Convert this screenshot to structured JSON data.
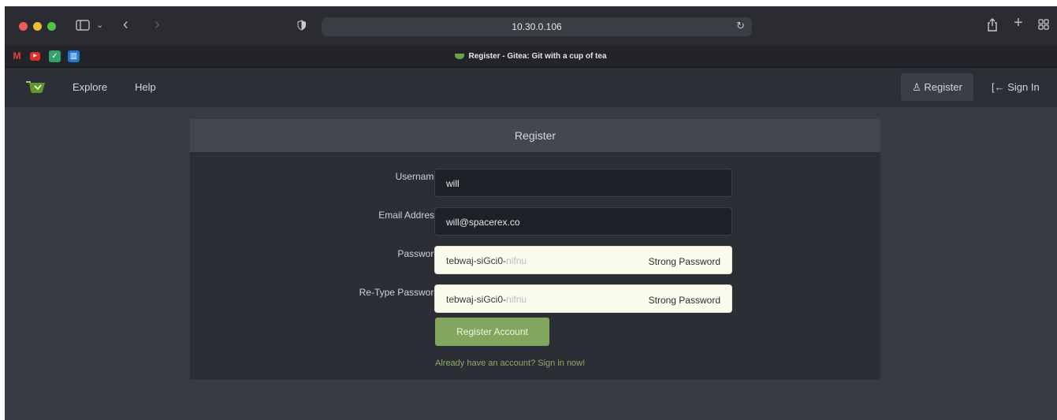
{
  "browser": {
    "url": "10.30.0.106",
    "tab_title": "Register - Gitea: Git with a cup of tea",
    "favorites": [
      "gmail-icon",
      "youtube-icon",
      "bookmark-app-icon",
      "trello-icon"
    ]
  },
  "nav": {
    "explore": "Explore",
    "help": "Help",
    "register": "Register",
    "signin": "Sign In"
  },
  "form": {
    "title": "Register",
    "username_label": "Username",
    "username_value": "will",
    "email_label": "Email Address",
    "email_value": "will@spacerex.co",
    "password_label": "Password",
    "password_value": "tebwaj-siGci0-",
    "password_value_faded": "nifnu",
    "password_hint": "Strong Password",
    "retype_label": "Re-Type Password",
    "retype_value": "tebwaj-siGci0-",
    "retype_value_faded": "nifnu",
    "retype_hint": "Strong Password",
    "submit": "Register Account",
    "signin_prompt": "Already have an account? Sign in now!"
  },
  "colors": {
    "accent": "#82a65d",
    "required": "#db3b3b",
    "background": "#383b44"
  }
}
